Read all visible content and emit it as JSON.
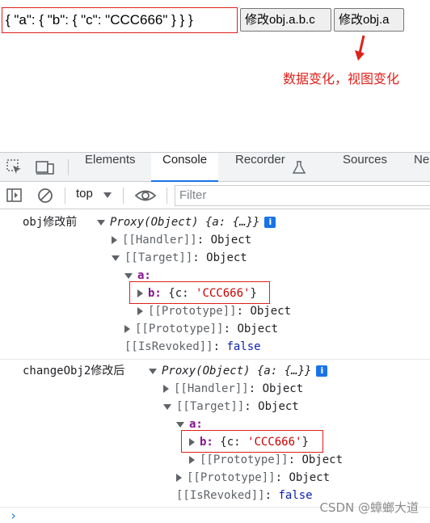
{
  "demo": {
    "json_text": "{ \"a\": { \"b\": { \"c\": \"CCC666\" } } }",
    "button1_label": "修改obj.a.b.c",
    "button2_label": "修改obj.a",
    "note": "数据变化，视图变化"
  },
  "devtools": {
    "tabs": [
      "Elements",
      "Console",
      "Recorder",
      "Sources",
      "Ne"
    ],
    "active_tab": "Console",
    "context": "top",
    "filter_placeholder": "Filter"
  },
  "log1": {
    "label": "obj修改前",
    "summary": "Proxy(Object) {a: {…}}",
    "handler_key": "[[Handler]]",
    "handler_val": "Object",
    "target_key": "[[Target]]",
    "target_val": "Object",
    "a_key": "a:",
    "b_key": "b:",
    "b_val_prefix": "{c: ",
    "b_val_str": "'CCC666'",
    "b_val_suffix": "}",
    "proto_key": "[[Prototype]]",
    "proto_val": "Object",
    "revoked_key": "[[IsRevoked]]",
    "revoked_val": "false"
  },
  "log2": {
    "label": "changeObj2修改后",
    "summary": "Proxy(Object) {a: {…}}",
    "handler_key": "[[Handler]]",
    "handler_val": "Object",
    "target_key": "[[Target]]",
    "target_val": "Object",
    "a_key": "a:",
    "b_key": "b:",
    "b_val_prefix": "{c: ",
    "b_val_str": "'CCC666'",
    "b_val_suffix": "}",
    "proto_key": "[[Prototype]]",
    "proto_val": "Object",
    "revoked_key": "[[IsRevoked]]",
    "revoked_val": "false"
  },
  "watermark": "CSDN @蟑螂大道",
  "colors": {
    "accent": "#1a73e8",
    "highlight": "#e0201a"
  }
}
